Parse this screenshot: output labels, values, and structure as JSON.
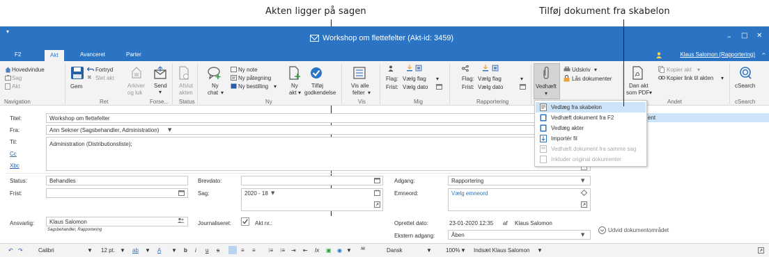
{
  "callouts": {
    "left": "Akten ligger på sagen",
    "right": "Tilføj dokument fra skabelon"
  },
  "window": {
    "title": "Workshop om flettefelter (Akt-id: 3459)",
    "menu_glyph": "▾",
    "minimize": "–",
    "maximize": "□",
    "close": "✕",
    "collapse": "^"
  },
  "tabs": [
    {
      "label": "F2"
    },
    {
      "label": "Akt"
    },
    {
      "label": "Avanceret"
    },
    {
      "label": "Parter"
    }
  ],
  "user": "Klaus Salomon (Rapportering)",
  "ribbon": {
    "navigation": {
      "hovedvindue": "Hovedvindue",
      "sag": "Sag",
      "akt": "Akt",
      "label": "Navigation"
    },
    "ret": {
      "gem": "Gem",
      "fortryd": "Fortryd",
      "slet_akt": "Slet akt",
      "arkiver": "Arkiver",
      "og_luk": "og luk",
      "send": "Send",
      "label": "Ret"
    },
    "forse": {
      "label": "Forse..."
    },
    "status": {
      "afslut": "Afslut",
      "akten": "akten",
      "label": "Status"
    },
    "ny": {
      "ny_chat_1": "Ny",
      "ny_chat_2": "chat",
      "ny_note": "Ny note",
      "ny_paategning": "Ny påtegning",
      "ny_bestilling": "Ny bestilling",
      "ny_akt_1": "Ny",
      "ny_akt_2": "akt",
      "tilfoej": "Tilføj",
      "godkendelse": "godkendelse",
      "label": "Ny"
    },
    "vis": {
      "vis_alle": "Vis alle",
      "felter": "felter",
      "label": "Vis"
    },
    "mig": {
      "flag_label": "Flag:",
      "flag_value": "Vælg flag",
      "frist_label": "Frist:",
      "frist_value": "Vælg dato",
      "label": "Mig"
    },
    "rapportering": {
      "flag_label": "Flag:",
      "flag_value": "Vælg flag",
      "frist_label": "Frist:",
      "frist_value": "Vælg dato",
      "label": "Rapportering"
    },
    "vedhaeft": {
      "label": "Vedhæft"
    },
    "udskriv": {
      "udskriv": "Udskriv",
      "laas": "Lås dokumenter"
    },
    "andet": {
      "dan_akt": "Dan akt",
      "som_pdf": "som PDF",
      "kopier_akt": "Kopier akt",
      "kopier_link": "Kopier link til akten",
      "label": "Andet"
    },
    "csearch": {
      "label_btn": "cSearch",
      "label": "cSearch"
    }
  },
  "dropdown": [
    {
      "label": "Vedlæg fra skabelon",
      "icon": "template-icon",
      "highlighted": true,
      "disabled": false
    },
    {
      "label": "Vedhæft dokument fra F2",
      "icon": "f2-document-icon",
      "highlighted": false,
      "disabled": false
    },
    {
      "label": "Vedlæg akter",
      "icon": "records-icon",
      "highlighted": false,
      "disabled": false
    },
    {
      "label": "Importér fil",
      "icon": "import-file-icon",
      "highlighted": false,
      "disabled": false
    },
    {
      "label": "Vedhæft dokument fra samme sag",
      "icon": "same-case-document-icon",
      "highlighted": false,
      "disabled": true
    },
    {
      "label": "Inkluder original dokumenter",
      "icon": "original-documents-icon",
      "highlighted": false,
      "disabled": true
    }
  ],
  "form": {
    "titel_label": "Titel:",
    "titel_value": "Workshop om flettefelter",
    "fra_label": "Fra:",
    "fra_value": "Ann Sekner (Sagsbehandler, Administration)",
    "til_label": "Til:",
    "til_value": "Administration (Distributionsliste);",
    "cc_label": "Cc",
    "bcc_label": "Xbc",
    "status_label": "Status:",
    "status_value": "Behandles",
    "frist_label": "Frist:",
    "brevdato_label": "Brevdato:",
    "sag_label": "Sag:",
    "sag_value": "2020 - 18",
    "adgang_label": "Adgang:",
    "adgang_value": "Rapportering",
    "emneord_label": "Emneord:",
    "emneord_placeholder": "Vælg emneord",
    "ansvarlig_label": "Ansvarlig:",
    "ansvarlig_value": "Klaus Salomon",
    "ansvarlig_sub": "Sagsbehandler, Rapportering",
    "journaliseret_label": "Journaliseret:",
    "akt_nr_label": "Akt nr.:",
    "oprettet_label": "Oprettet dato:",
    "oprettet_value": "23-01-2020 12:35",
    "oprettet_af": "af",
    "oprettet_user": "Klaus Salomon",
    "ekstern_label": "Ekstern adgang:",
    "ekstern_value": "Åben",
    "right_header": "ent",
    "udvid": "Udvid dokumentområdet"
  },
  "bottombar": {
    "font": "Calibri",
    "size": "12 pt.",
    "language": "Dansk",
    "zoom": "100%",
    "insert": "Indsæt Klaus Salomon"
  }
}
